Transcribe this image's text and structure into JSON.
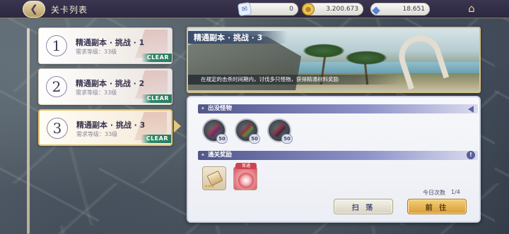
{
  "topbar": {
    "back_icon": "back-arrow-icon",
    "title": "关卡列表",
    "resources": [
      {
        "name": "ticket",
        "icon": "ticket-icon",
        "value": "0"
      },
      {
        "name": "gold",
        "icon": "coin-icon",
        "value": "3.200.673"
      },
      {
        "name": "crystal",
        "icon": "crystal-icon",
        "value": "18.651"
      }
    ],
    "shop_icon": "shop-icon"
  },
  "stages": [
    {
      "number": "1",
      "name": "精通副本 · 挑战 · 1",
      "requirement": "需求等级：33级",
      "status": "CLEAR",
      "selected": false
    },
    {
      "number": "2",
      "name": "精通副本 · 挑战 · 2",
      "requirement": "需求等级：33级",
      "status": "CLEAR",
      "selected": false
    },
    {
      "number": "3",
      "name": "精通副本 · 挑战 · 3",
      "requirement": "需求等级：33级",
      "status": "CLEAR",
      "selected": true
    }
  ],
  "banner": {
    "title": "精通副本 · 挑战 · 3",
    "description": "在规定的击杀时间期内，讨伐多只怪物，获得精通材料奖励"
  },
  "monsters": {
    "header": "出没怪物",
    "items": [
      {
        "level": "50"
      },
      {
        "level": "50"
      },
      {
        "level": "50"
      }
    ]
  },
  "rewards": {
    "header": "通关奖励",
    "info_icon": "info-icon",
    "items": [
      {
        "name": "scroll",
        "stars": "★★★"
      },
      {
        "name": "flower",
        "tag": "首通"
      }
    ]
  },
  "attempts": {
    "label": "今日次数",
    "value": "1/4"
  },
  "buttons": {
    "sweep": "扫 荡",
    "go": "前 往"
  },
  "colors": {
    "accent": "#e8c46a",
    "clear_badge": "#2f8a6a",
    "section_header": "#51568c"
  }
}
